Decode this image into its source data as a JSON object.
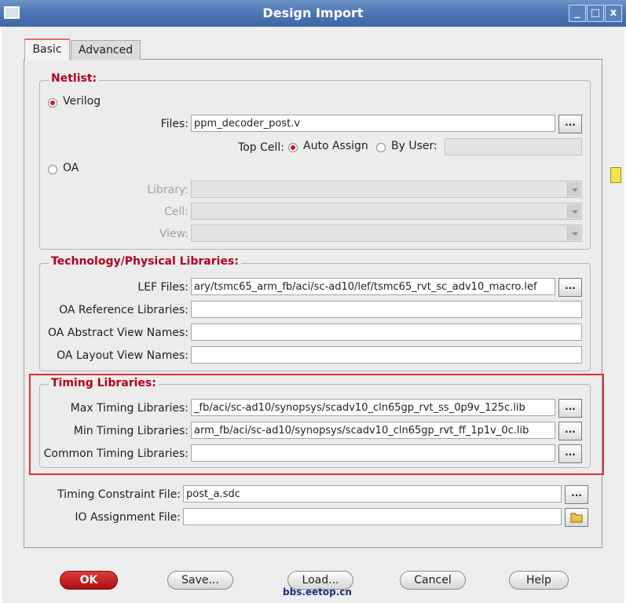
{
  "window": {
    "title": "Design Import",
    "controls": {
      "minimize": "_",
      "maximize": "□",
      "close": "x"
    }
  },
  "tabs": [
    {
      "label": "Basic",
      "selected": true
    },
    {
      "label": "Advanced",
      "selected": false
    }
  ],
  "netlist": {
    "title": "Netlist:",
    "verilog_label": "Verilog",
    "verilog_selected": true,
    "files_label": "Files:",
    "files_value": "ppm_decoder_post.v",
    "top_cell_label": "Top Cell:",
    "auto_assign_label": "Auto Assign",
    "by_user_label": "By User:",
    "by_user_value": "",
    "oa_label": "OA",
    "library_label": "Library:",
    "cell_label": "Cell:",
    "view_label": "View:"
  },
  "tech": {
    "title": "Technology/Physical Libraries:",
    "lef_label": "LEF Files:",
    "lef_value": "ary/tsmc65_arm_fb/aci/sc-ad10/lef/tsmc65_rvt_sc_adv10_macro.lef",
    "oa_ref_label": "OA Reference Libraries:",
    "oa_abstract_label": "OA Abstract View Names:",
    "oa_layout_label": "OA Layout View Names:"
  },
  "timing": {
    "title": "Timing Libraries:",
    "max_label": "Max Timing Libraries:",
    "max_value": "_fb/aci/sc-ad10/synopsys/scadv10_cln65gp_rvt_ss_0p9v_125c.lib",
    "min_label": "Min Timing Libraries:",
    "min_value": "arm_fb/aci/sc-ad10/synopsys/scadv10_cln65gp_rvt_ff_1p1v_0c.lib",
    "common_label": "Common Timing Libraries:",
    "common_value": ""
  },
  "constraints": {
    "sdc_label": "Timing Constraint File:",
    "sdc_value": "post_a.sdc",
    "io_label": "IO Assignment File:",
    "io_value": ""
  },
  "browse_label": "...",
  "buttons": {
    "ok": "OK",
    "save": "Save...",
    "load": "Load...",
    "cancel": "Cancel",
    "help": "Help"
  },
  "watermark": "bbs.eetop.cn",
  "colors": {
    "accent_red": "#b3001e",
    "titlebar_blue": "#4b74b4",
    "highlight": "#d8343a"
  }
}
